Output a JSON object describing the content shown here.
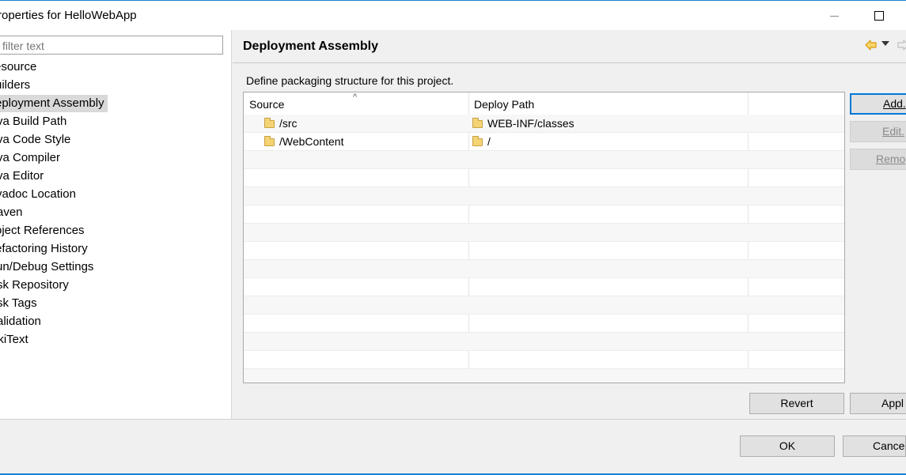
{
  "window": {
    "title": "roperties for HelloWebApp"
  },
  "filter": {
    "placeholder": "filter text"
  },
  "tree": {
    "items": [
      {
        "label": "esource"
      },
      {
        "label": "uilders"
      },
      {
        "label": "eployment Assembly",
        "selected": true
      },
      {
        "label": "va Build Path"
      },
      {
        "label": "va Code Style"
      },
      {
        "label": "va Compiler"
      },
      {
        "label": "va Editor"
      },
      {
        "label": "vadoc Location"
      },
      {
        "label": "aven"
      },
      {
        "label": "oject References"
      },
      {
        "label": "efactoring History"
      },
      {
        "label": "un/Debug Settings"
      },
      {
        "label": "sk Repository"
      },
      {
        "label": "sk Tags"
      },
      {
        "label": "alidation"
      },
      {
        "label": "ikiText"
      }
    ]
  },
  "page": {
    "title": "Deployment Assembly",
    "description": "Define packaging structure for this project."
  },
  "table": {
    "columns": [
      "Source",
      "Deploy Path"
    ],
    "rows": [
      {
        "source": "/src",
        "deploy": "WEB-INF/classes"
      },
      {
        "source": "/WebContent",
        "deploy": "/"
      }
    ]
  },
  "buttons": {
    "add": "Add.",
    "edit": "Edit.",
    "remove": "Remo",
    "revert": "Revert",
    "apply": "Appl",
    "ok": "OK",
    "cancel": "Cance"
  },
  "icons": {
    "back": "back-arrow-icon",
    "menu": "dropdown-caret-icon",
    "forward": "forward-arrow-icon",
    "folder": "folder-icon"
  },
  "colors": {
    "accent": "#1883d7",
    "arrow_active": "#e3a916",
    "folder": "#f4d374",
    "selection": "#d9d9d9"
  }
}
